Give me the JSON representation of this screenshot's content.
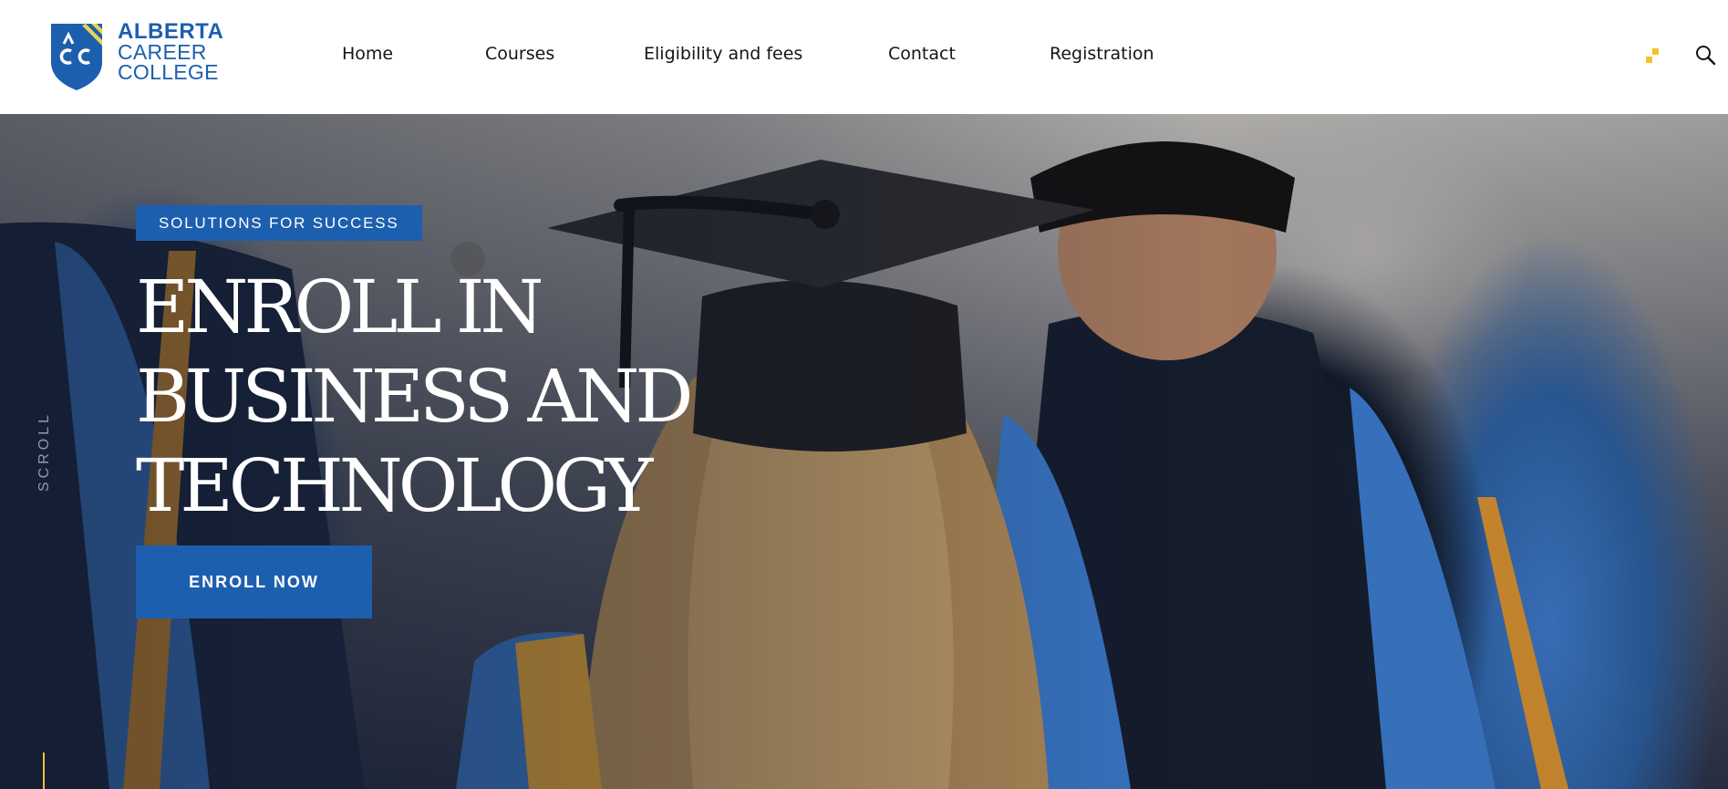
{
  "brand": {
    "line1": "ALBERTA",
    "line2": "CAREER",
    "line3": "COLLEGE",
    "primary_color": "#1d5faf",
    "accent_color": "#f2c230"
  },
  "nav": {
    "home": "Home",
    "courses": "Courses",
    "eligibility": "Eligibility and fees",
    "contact": "Contact",
    "registration": "Registration"
  },
  "header_icons": {
    "menu": "dots-icon",
    "search": "search-icon"
  },
  "hero": {
    "tagline": "SOLUTIONS FOR SUCCESS",
    "headline_line1": "ENROLL IN",
    "headline_line2": "BUSINESS AND",
    "headline_line3": "TECHNOLOGY",
    "cta": "ENROLL NOW",
    "scroll_label": "SCROLL"
  }
}
